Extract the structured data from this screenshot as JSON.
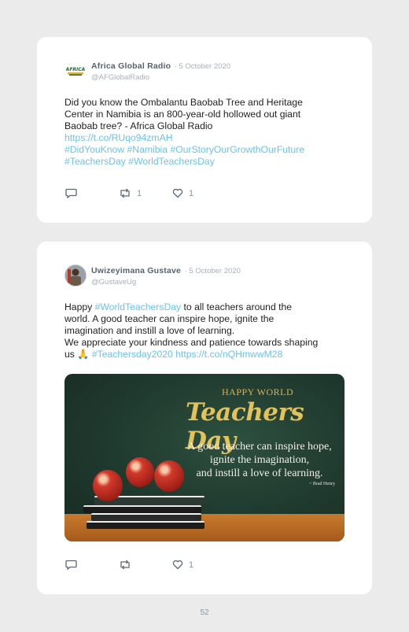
{
  "posts": [
    {
      "author_name": "Africa Global Radio",
      "date": "5 October 2020",
      "handle": "@AFGlobalRadio",
      "avatar_text": "AFRICA",
      "text_lines": [
        "Did you know the Ombalantu Baobab Tree and Heritage",
        "Center in Namibia is an 800-year-old hollowed out giant",
        "Baobab tree? - Africa Global Radio"
      ],
      "links": [
        "https://t.co/RUqo94zmAH",
        "#DidYouKnow #Namibia #OurStoryOurGrowthOurFuture",
        "#TeachersDay #WorldTeachersDay"
      ],
      "retweets": "1",
      "likes": "1"
    },
    {
      "author_name": "Uwizeyimana Gustave",
      "date": "5 October 2020",
      "handle": "@GustaveUg",
      "text": {
        "l1_pre": "Happy ",
        "l1_link": "#WorldTeachersDay",
        "l1_post": " to all teachers around the",
        "l2": "world. A good teacher can inspire hope, ignite the",
        "l3": "imagination and instill a love of learning.",
        "l4": "We appreciate your kindness and patience towards shaping",
        "l5_pre": "us 🙏 ",
        "l5_link1": "#Teachersday2020",
        "l5_link2": "https://t.co/nQHmwwM28"
      },
      "media": {
        "heading_small": "Happy World",
        "heading_big": "Teachers Day",
        "quote_lines": [
          "A good teacher can inspire hope,",
          "ignite the imagination,",
          "and instill a love of learning."
        ],
        "quote_author": "~ Brad Henry"
      },
      "likes": "1"
    }
  ],
  "page_number": "52"
}
